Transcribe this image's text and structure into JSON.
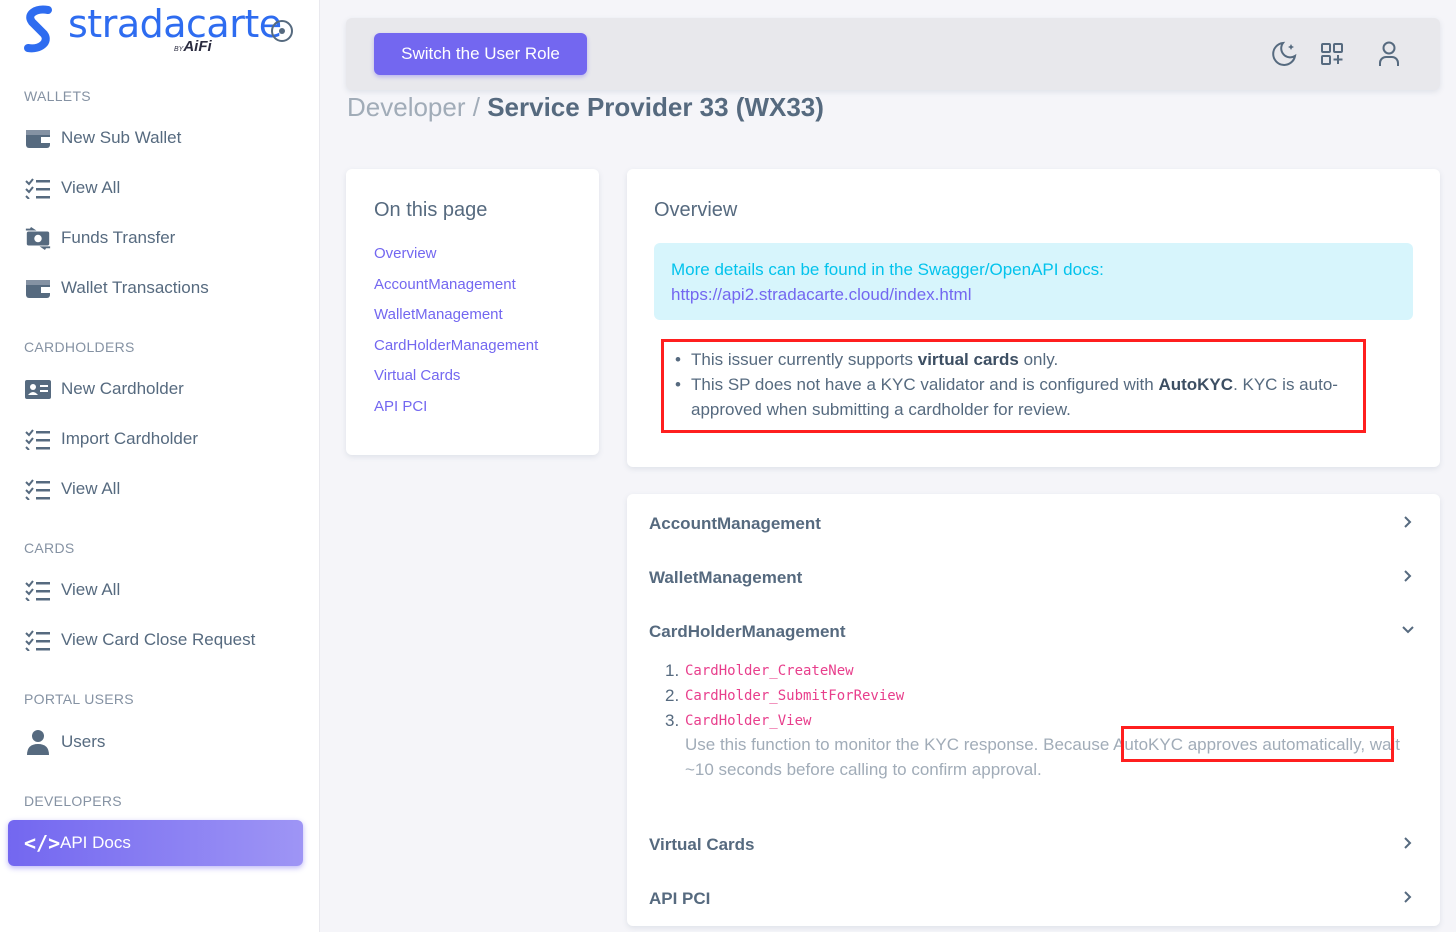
{
  "brand": {
    "name": "stradacarte",
    "by_small": "BY",
    "by": "AiFi"
  },
  "sidebar": {
    "sections": [
      {
        "title": "WALLETS",
        "items": [
          "New Sub Wallet",
          "View All",
          "Funds Transfer",
          "Wallet Transactions"
        ]
      },
      {
        "title": "CARDHOLDERS",
        "items": [
          "New Cardholder",
          "Import Cardholder",
          "View All"
        ]
      },
      {
        "title": "CARDS",
        "items": [
          "View All",
          "View Card Close Request"
        ]
      },
      {
        "title": "PORTAL USERS",
        "items": [
          "Users"
        ]
      },
      {
        "title": "DEVELOPERS",
        "items": [
          "API Docs"
        ]
      }
    ],
    "active_icon": "</>"
  },
  "topbar": {
    "switch_role": "Switch the User Role"
  },
  "breadcrumb": {
    "parent": "Developer /",
    "current": "Service Provider 33 (WX33)"
  },
  "toc": {
    "title": "On this page",
    "links": [
      "Overview",
      "AccountManagement",
      "WalletManagement",
      "CardHolderManagement",
      "Virtual Cards",
      "API PCI"
    ]
  },
  "overview": {
    "title": "Overview",
    "info_line1": "More details can be found in the Swagger/OpenAPI docs:",
    "info_link": "https://api2.stradacarte.cloud/index.html",
    "b1_pre": "This issuer currently supports ",
    "b1_bold": "virtual cards",
    "b1_post": " only.",
    "b2_pre": "This SP does not have a KYC validator and is configured with ",
    "b2_bold": "AutoKYC",
    "b2_post": ". KYC is auto-approved when submitting a cardholder for review."
  },
  "accordion": {
    "sections": [
      "AccountManagement",
      "WalletManagement",
      "CardHolderManagement",
      "Virtual Cards",
      "API PCI"
    ],
    "functions": [
      {
        "num": "1.",
        "name": "CardHolder_CreateNew"
      },
      {
        "num": "2.",
        "name": "CardHolder_SubmitForReview"
      },
      {
        "num": "3.",
        "name": "CardHolder_View"
      }
    ],
    "desc": "Use this function to monitor the KYC response. Because AutoKYC approves automatically, wait ~10 seconds before calling to confirm approval."
  },
  "colors": {
    "accent": "#7367f0",
    "info_bg": "#d7f5fc",
    "highlight": "#ff1f1f",
    "code": "#e83e8c"
  }
}
